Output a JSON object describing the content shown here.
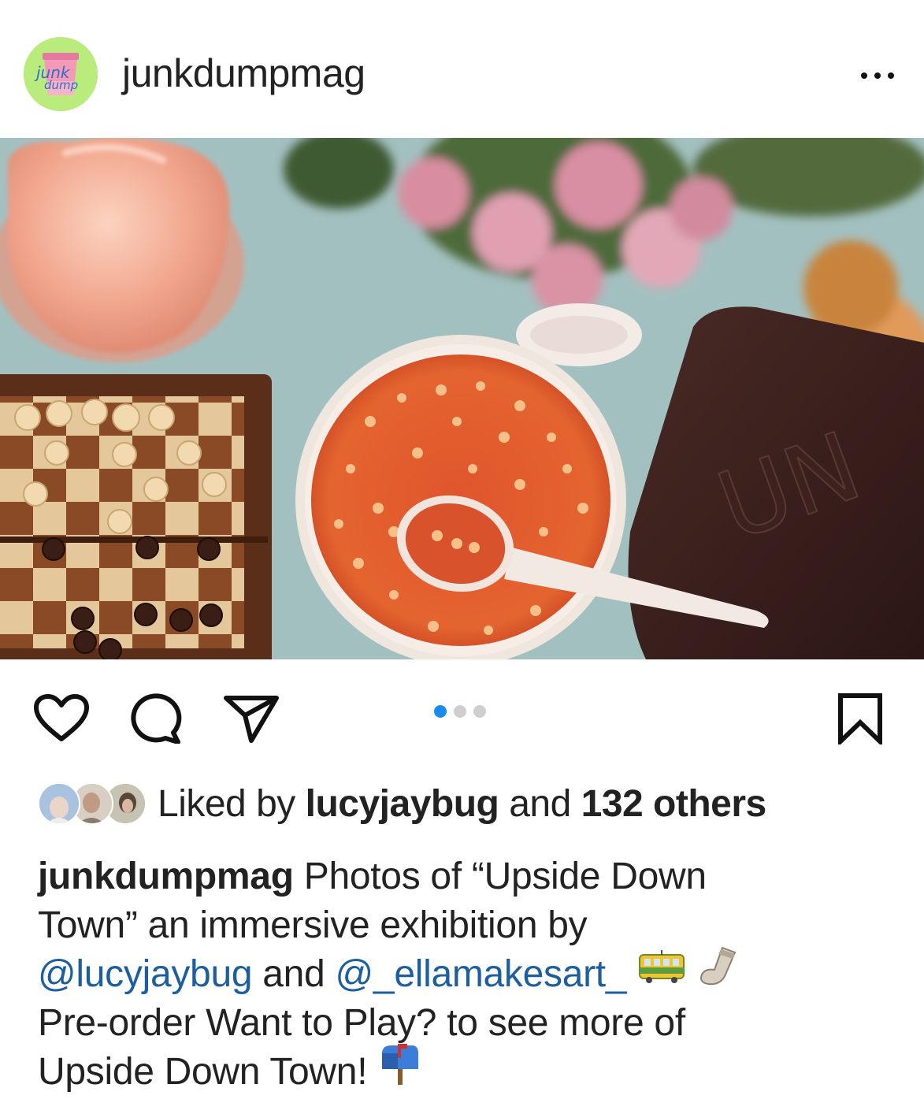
{
  "header": {
    "username": "junkdumpmag",
    "avatar_text_top": "junk",
    "avatar_text_bottom": "dump",
    "more_icon": "more-horizontal-icon"
  },
  "media": {
    "description_icon": "photo",
    "carousel": {
      "total": 3,
      "active_index": 0
    },
    "mug_logo_text": "UN"
  },
  "actions": {
    "like_icon": "heart-outline-icon",
    "comment_icon": "comment-bubble-icon",
    "share_icon": "paper-plane-icon",
    "save_icon": "bookmark-outline-icon"
  },
  "likes": {
    "prefix": "Liked by ",
    "user": "lucyjaybug",
    "middle": " and ",
    "others": "132 others"
  },
  "caption": {
    "username": "junkdumpmag",
    "line1_text": " Photos of “Upside Down",
    "line2_text": "Town” an immersive exhibition by",
    "mention1": "@lucyjaybug",
    "and_text": " and ",
    "mention2": "@_ellamakesart_",
    "line4_text": "Pre-order Want to Play? to see more of",
    "line5_text": "Upside Down Town!",
    "emojis": [
      "tram-emoji",
      "sock-emoji",
      "mailbox-emoji"
    ]
  },
  "colors": {
    "link": "#1d5e9f",
    "carousel_active": "#1a8cf0",
    "carousel_inactive": "#cfcfcf"
  }
}
